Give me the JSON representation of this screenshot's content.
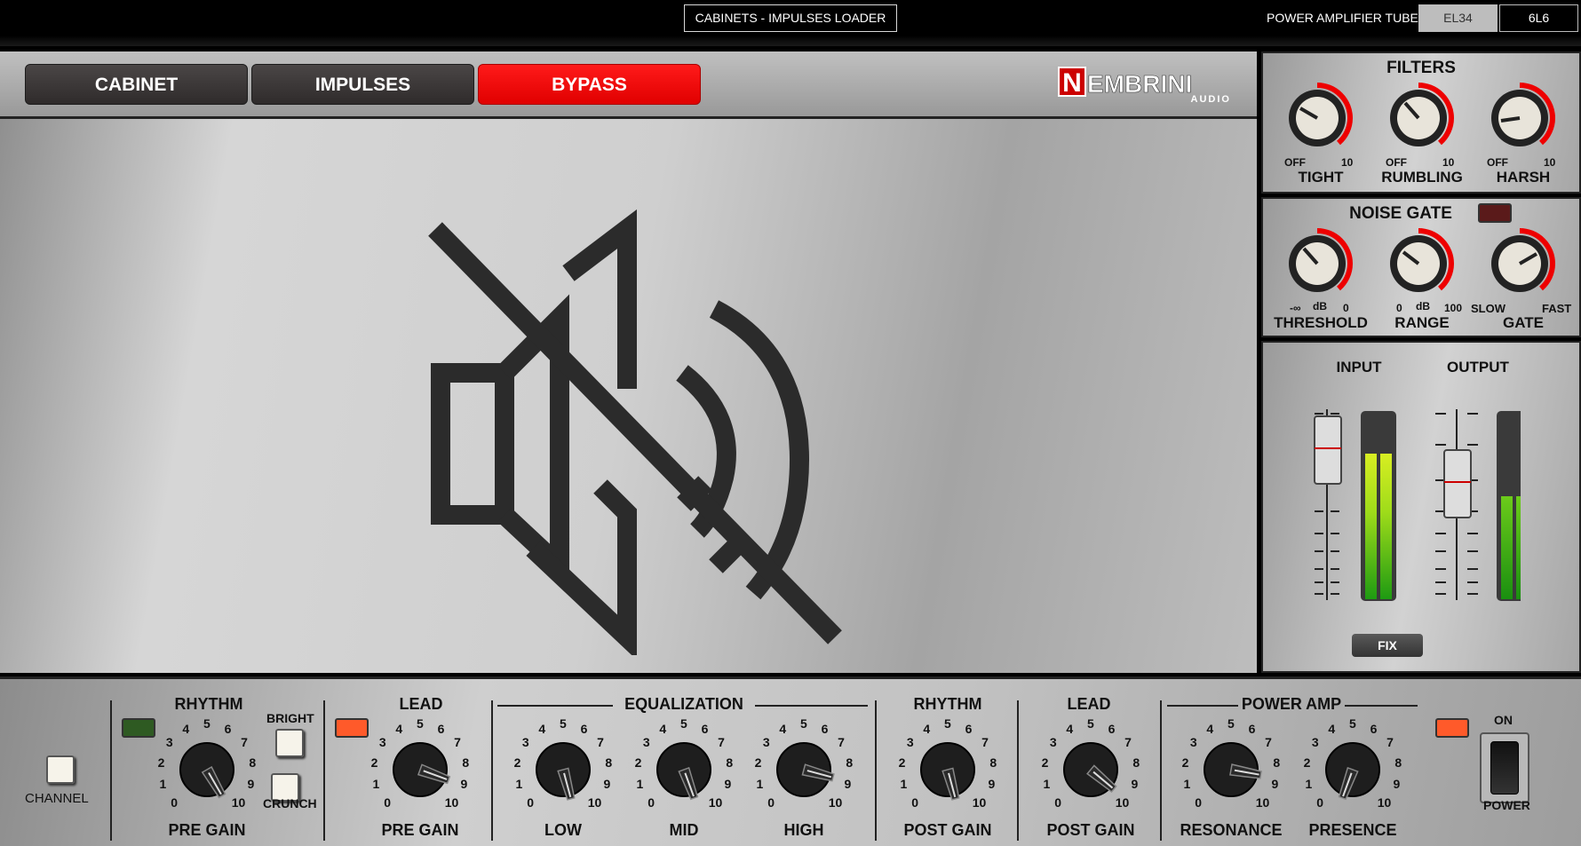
{
  "topbar": {
    "title": "CABINETS - IMPULSES LOADER",
    "tube_label": "POWER AMPLIFIER TUBE",
    "tube_options": [
      "EL34",
      "6L6"
    ]
  },
  "tabs": {
    "cabinet": "CABINET",
    "impulses": "IMPULSES",
    "bypass": "BYPASS"
  },
  "logo": {
    "brand": "NEMBRINI",
    "sub": "AUDIO"
  },
  "filters": {
    "title": "FILTERS",
    "knobs": [
      {
        "label": "TIGHT",
        "min": "OFF",
        "max": "10"
      },
      {
        "label": "RUMBLING",
        "min": "OFF",
        "max": "10"
      },
      {
        "label": "HARSH",
        "min": "OFF",
        "max": "10"
      }
    ]
  },
  "noise_gate": {
    "title": "NOISE GATE",
    "knobs": [
      {
        "label": "THRESHOLD",
        "min": "-∞",
        "unit": "dB",
        "max": "0"
      },
      {
        "label": "RANGE",
        "min": "0",
        "unit": "dB",
        "max": "100"
      },
      {
        "label": "GATE",
        "min": "SLOW",
        "max": "FAST"
      }
    ]
  },
  "io": {
    "input": "INPUT",
    "output": "OUTPUT",
    "fix": "FIX"
  },
  "bottom": {
    "channel": "CHANNEL",
    "rhythm": "RHYTHM",
    "lead": "LEAD",
    "equalization": "EQUALIZATION",
    "power_amp": "POWER AMP",
    "bright": "BRIGHT",
    "crunch": "CRUNCH",
    "on": "ON",
    "power": "POWER",
    "scale": [
      "0",
      "1",
      "2",
      "3",
      "4",
      "5",
      "6",
      "7",
      "8",
      "9",
      "10"
    ],
    "knob_labels": [
      "PRE GAIN",
      "PRE GAIN",
      "LOW",
      "MID",
      "HIGH",
      "POST GAIN",
      "POST GAIN",
      "RESONANCE",
      "PRESENCE"
    ]
  },
  "colors": {
    "accent_red": "#e00000",
    "led_off": "#3a6a2a",
    "led_on": "#ff5a2a",
    "meter_green": "#5ec21a"
  }
}
